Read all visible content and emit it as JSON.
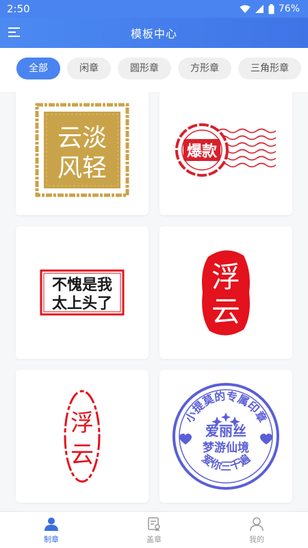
{
  "status": {
    "time": "2:50",
    "battery": "76%"
  },
  "header": {
    "title": "模板中心"
  },
  "chips": [
    {
      "label": "全部",
      "active": true
    },
    {
      "label": "闲章",
      "active": false
    },
    {
      "label": "圆形章",
      "active": false
    },
    {
      "label": "方形章",
      "active": false
    },
    {
      "label": "三角形章",
      "active": false
    }
  ],
  "stamps": {
    "s1": {
      "text": "云淡风轻",
      "l1": "云淡",
      "l2": "风轻",
      "color": "#c9a349"
    },
    "s2": {
      "text": "爆款",
      "color": "#d8202b"
    },
    "s3": {
      "l1": "不愧是我",
      "l2": "太上头了",
      "color": "#e0161e"
    },
    "s4": {
      "text": "浮云",
      "c1": "浮",
      "c2": "云",
      "color": "#e3121c"
    },
    "s5": {
      "text": "浮云",
      "c1": "浮",
      "c2": "云",
      "color": "#e3121c"
    },
    "s6": {
      "arc_top": "小提莫的专属印章",
      "l1": "爱丽丝",
      "l2": "梦游仙境",
      "arc_bottom": "爱你三千遍",
      "color": "#5a5fd6"
    }
  },
  "nav": [
    {
      "label": "制章",
      "icon": "user-icon",
      "active": true
    },
    {
      "label": "盖章",
      "icon": "stamp-doc-icon",
      "active": false
    },
    {
      "label": "我的",
      "icon": "profile-icon",
      "active": false
    }
  ],
  "colors": {
    "primary": "#4a84f0",
    "gold": "#c9a349",
    "red": "#e0161e",
    "purple": "#5a5fd6"
  }
}
